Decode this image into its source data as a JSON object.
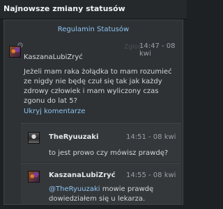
{
  "header": {
    "title": "Najnowsze zmiany statusów"
  },
  "rules_link": "Regulamin Statusów",
  "report_label": "Zgłoś",
  "post": {
    "user": "KaszanaLubiZryć",
    "time": "14:47 - 08 kwi",
    "lines": [
      "Jeżeli mam raka żołądka to mam rozumieć",
      "ze nigdy nie będę czuł się tak jak każdy",
      "zdrowy człowiek i mam wyliczony czas",
      "zgonu do lat 5?"
    ],
    "hide_comments": "Ukryj komentarze"
  },
  "comments": [
    {
      "user": "TheRyuuzaki",
      "time": "14:51 - 08 kwi",
      "text": "to jest prowo czy mówisz prawdę?"
    },
    {
      "user": "KaszanaLubiZryć",
      "time": "14:55 - 08 kwi",
      "mention": "@TheRyuuzaki",
      "line1_rest": " mowie prawdę",
      "line2": "dowiedziałem się u lekarza."
    }
  ]
}
